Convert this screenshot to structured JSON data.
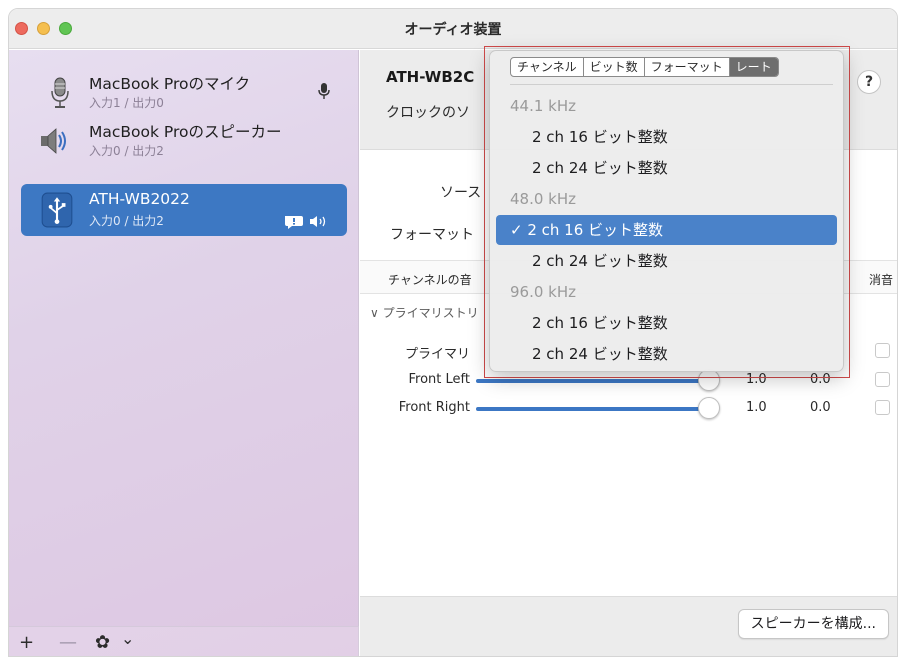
{
  "window": {
    "title": "オーディオ装置"
  },
  "sidebar": {
    "devices": [
      {
        "name": "MacBook Proのマイク",
        "sub": "入力1 / 出力0",
        "icon": "microphone-icon",
        "selected": false
      },
      {
        "name": "MacBook Proのスピーカー",
        "sub": "入力0 / 出力2",
        "icon": "speaker-icon",
        "selected": false
      },
      {
        "name": "ATH-WB2022",
        "sub": "入力0 / 出力2",
        "icon": "usb-icon",
        "selected": true
      }
    ],
    "footer": {
      "add": "+",
      "remove": "—",
      "gear": "✿",
      "chevron": "⌄"
    }
  },
  "main": {
    "device_title": "ATH-WB2C",
    "clock_label": "クロックのソ",
    "help": "?",
    "source_label": "ソース",
    "format_label": "フォーマット",
    "volume_header": {
      "channel": "チャンネルの音",
      "mute": "消音"
    },
    "group_label": "∨ プライマリストリ",
    "rows": [
      {
        "name": "プライマリ",
        "v1": "",
        "v2": ""
      },
      {
        "name": "Front Left",
        "v1": "1.0",
        "v2": "0.0"
      },
      {
        "name": "Front Right",
        "v1": "1.0",
        "v2": "0.0"
      }
    ],
    "configure_button": "スピーカーを構成..."
  },
  "dropdown": {
    "tabs": [
      "チャンネル",
      "ビット数",
      "フォーマット",
      "レート"
    ],
    "active_tab": "レート",
    "items": [
      {
        "label": "44.1 kHz",
        "type": "header"
      },
      {
        "label": "2 ch 16 ビット整数",
        "type": "item"
      },
      {
        "label": "2 ch 24 ビット整数",
        "type": "item"
      },
      {
        "label": "48.0 kHz",
        "type": "header"
      },
      {
        "label": "✓ 2 ch 16 ビット整数",
        "type": "selected"
      },
      {
        "label": "2 ch 24 ビット整数",
        "type": "item"
      },
      {
        "label": "96.0 kHz",
        "type": "header"
      },
      {
        "label": "2 ch 16 ビット整数",
        "type": "item"
      },
      {
        "label": "2 ch 24 ビット整数",
        "type": "item"
      }
    ]
  },
  "colors": {
    "accent": "#3d78c3",
    "highlight_box": "#d04a4a"
  }
}
